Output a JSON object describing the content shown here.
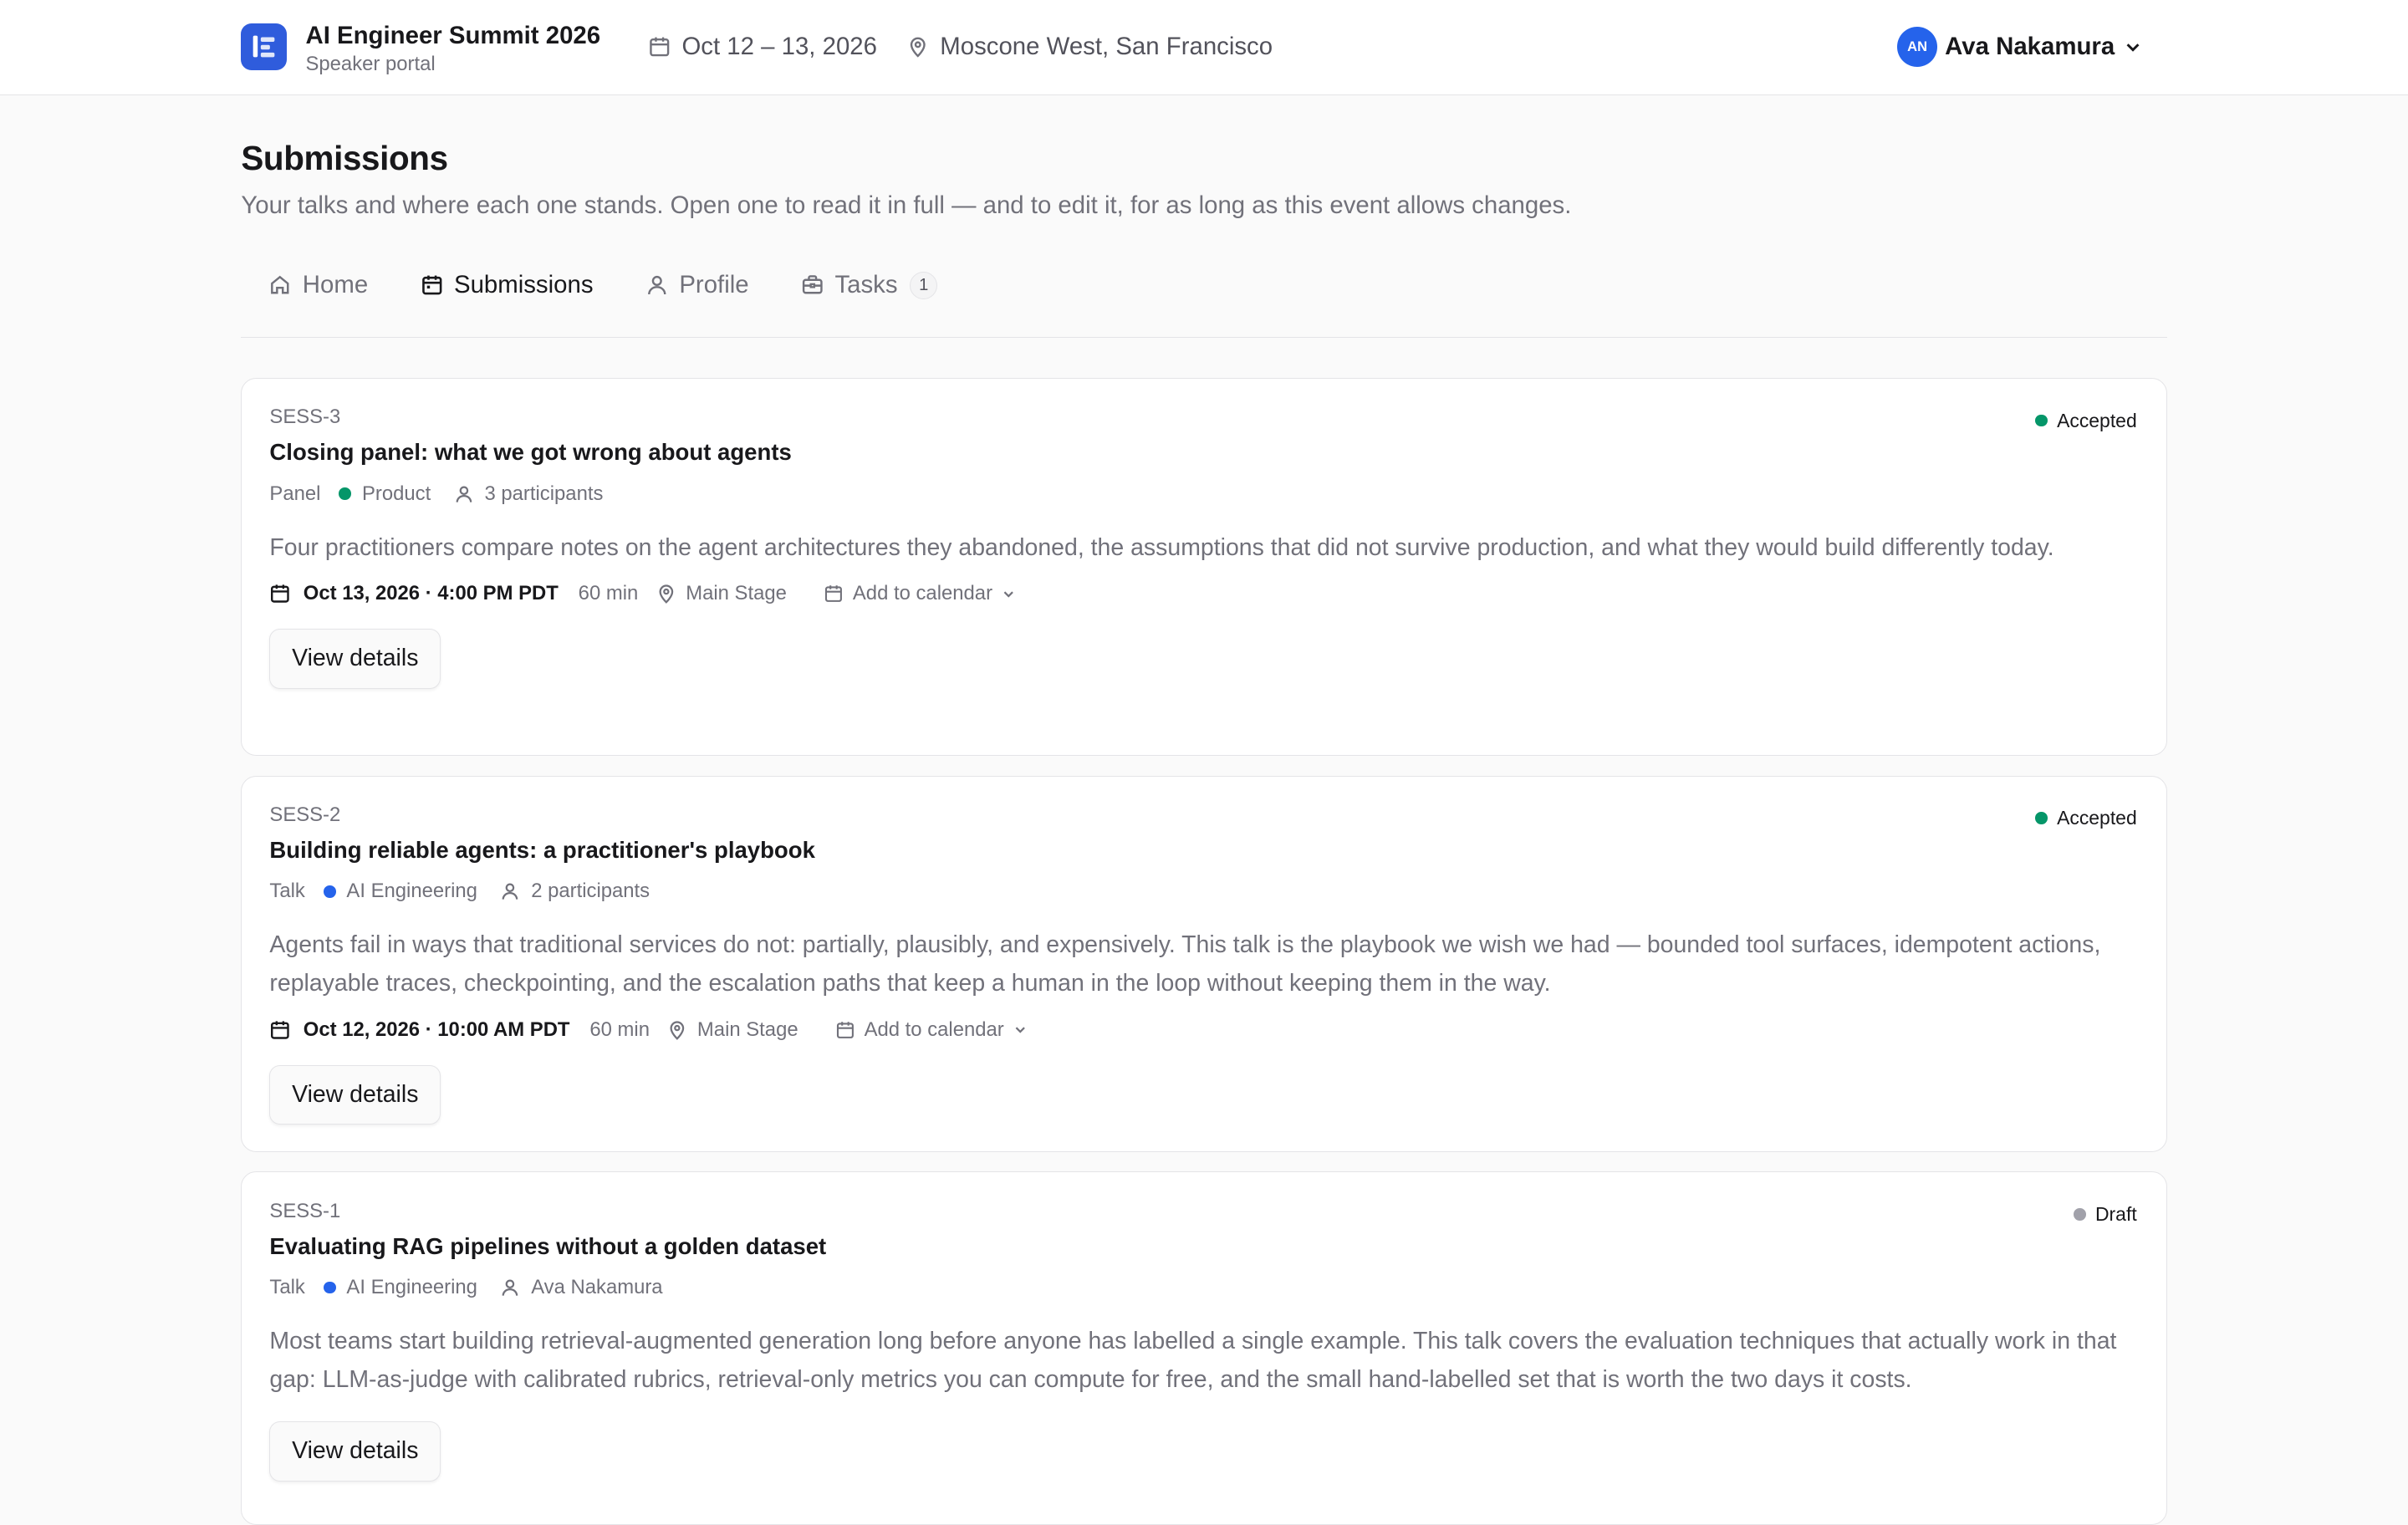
{
  "header": {
    "event_name": "AI Engineer Summit 2026",
    "portal_label": "Speaker portal",
    "dates": "Oct 12 – 13, 2026",
    "venue": "Moscone West, San Francisco",
    "user_initials": "AN",
    "user_name": "Ava Nakamura"
  },
  "page": {
    "title": "Submissions",
    "description": "Your talks and where each one stands. Open one to read it in full — and to edit it, for as long as this event allows changes."
  },
  "tabs": [
    {
      "label": "Home",
      "icon": "home-icon"
    },
    {
      "label": "Submissions",
      "icon": "calendar-icon",
      "active": true
    },
    {
      "label": "Profile",
      "icon": "user-icon"
    },
    {
      "label": "Tasks",
      "icon": "briefcase-icon",
      "badge": "1"
    }
  ],
  "colors": {
    "brand": "#2f5cdc",
    "accepted": "#059669",
    "draft": "#a1a1aa",
    "track_product": "#059669",
    "track_ai": "#2563eb"
  },
  "submissions": [
    {
      "id": "SESS-3",
      "title": "Closing panel: what we got wrong about agents",
      "status": "Accepted",
      "type": "Panel",
      "track": "Product",
      "people": "3 participants",
      "abstract": "Four practitioners compare notes on the agent architectures they abandoned, the assumptions that did not survive production, and what they would build differently today.",
      "date": "Oct 13, 2026 · 4:00 PM PDT",
      "duration": "60 min",
      "room": "Main Stage",
      "calendar": "Add to calendar",
      "button": "View details"
    },
    {
      "id": "SESS-2",
      "title": "Building reliable agents: a practitioner's playbook",
      "status": "Accepted",
      "type": "Talk",
      "track": "AI Engineering",
      "people": "2 participants",
      "abstract": "Agents fail in ways that traditional services do not: partially, plausibly, and expensively. This talk is the playbook we wish we had — bounded tool surfaces, idempotent actions, replayable traces, checkpointing, and the escalation paths that keep a human in the loop without keeping them in the way.",
      "date": "Oct 12, 2026 · 10:00 AM PDT",
      "duration": "60 min",
      "room": "Main Stage",
      "calendar": "Add to calendar",
      "button": "View details"
    },
    {
      "id": "SESS-1",
      "title": "Evaluating RAG pipelines without a golden dataset",
      "status": "Draft",
      "type": "Talk",
      "track": "AI Engineering",
      "people": "Ava Nakamura",
      "abstract": "Most teams start building retrieval-augmented generation long before anyone has labelled a single example. This talk covers the evaluation techniques that actually work in that gap: LLM-as-judge with calibrated rubrics, retrieval-only metrics you can compute for free, and the small hand-labelled set that is worth the two days it costs.",
      "button": "View details"
    }
  ]
}
